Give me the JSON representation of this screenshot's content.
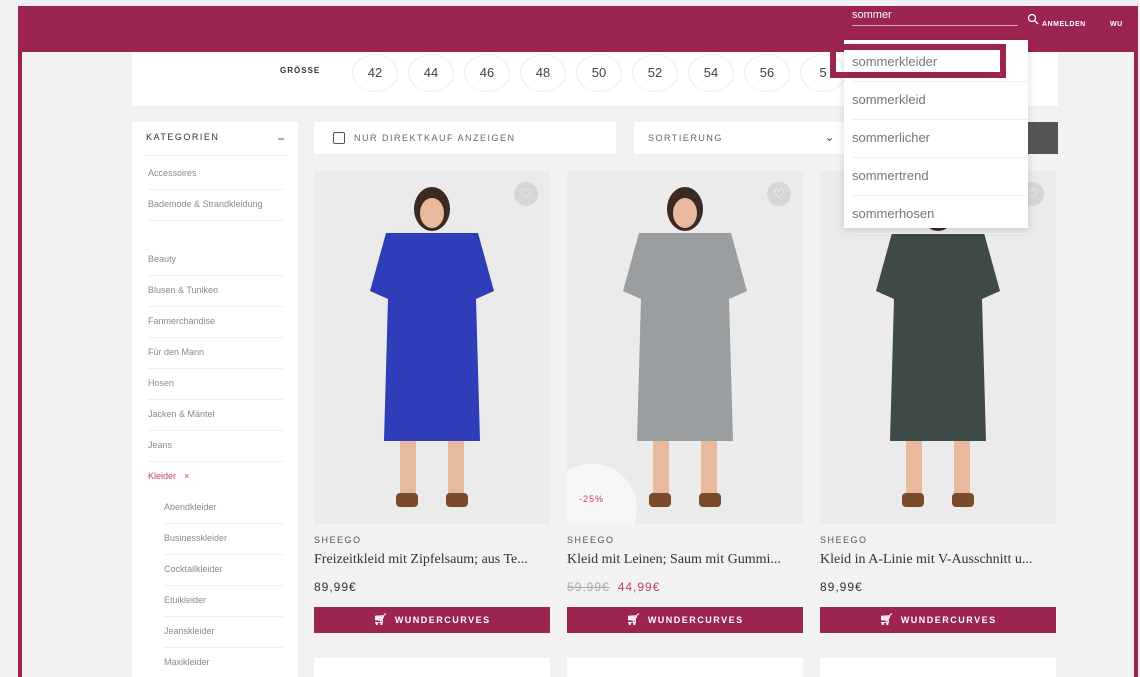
{
  "header": {
    "search_value": "sommer",
    "login_label": "ANMELDEN",
    "wishlist_label": "WU"
  },
  "size_filter": {
    "label": "GRÖSSE",
    "sizes": [
      "42",
      "44",
      "46",
      "48",
      "50",
      "52",
      "54",
      "56",
      "5"
    ]
  },
  "sidebar": {
    "title": "KATEGORIEN",
    "collapse_symbol": "−",
    "items": [
      {
        "label": "Accessoires"
      },
      {
        "label": "Bademode & Strandkleidung"
      },
      {
        "label": "Beauty"
      },
      {
        "label": "Blusen & Tuniken"
      },
      {
        "label": "Fanmerchandise"
      },
      {
        "label": "Für den Mann"
      },
      {
        "label": "Hosen"
      },
      {
        "label": "Jacken & Mäntel"
      },
      {
        "label": "Jeans"
      },
      {
        "label": "Kleider"
      },
      {
        "label": "Abendkleider"
      },
      {
        "label": "Businesskleider"
      },
      {
        "label": "Cocktailkleider"
      },
      {
        "label": "Etuikleider"
      },
      {
        "label": "Jeanskleider"
      },
      {
        "label": "Maxikleider"
      }
    ],
    "remove_symbol": "×"
  },
  "toolbar": {
    "direct_buy_label": "NUR DIREKTKAUF ANZEIGEN",
    "sort_label": "SORTIERUNG"
  },
  "products": [
    {
      "brand": "SHEEGO",
      "title": "Freizeitkleid mit Zipfelsaum; aus Te...",
      "price": "89,99€",
      "old_price": "",
      "new_price": "",
      "badge": "",
      "cta": "WUNDERCURVES",
      "dress_color": "#2f3db8"
    },
    {
      "brand": "SHEEGO",
      "title": "Kleid mit Leinen; Saum mit Gummi...",
      "price": "",
      "old_price": "59,99€",
      "new_price": "44,99€",
      "badge": "-25%",
      "cta": "WUNDERCURVES",
      "dress_color": "#9a9ea0"
    },
    {
      "brand": "SHEEGO",
      "title": "Kleid in A-Linie mit V-Ausschnitt u...",
      "price": "89,99€",
      "old_price": "",
      "new_price": "",
      "badge": "",
      "cta": "WUNDERCURVES",
      "dress_color": "#3d4a47"
    }
  ],
  "search_suggestions": [
    "sommerkleider",
    "sommerkleid",
    "sommerlicher",
    "sommertrend",
    "sommerhosen"
  ],
  "colors": {
    "brand": "#9c2451",
    "accent_text": "#c2416d"
  }
}
